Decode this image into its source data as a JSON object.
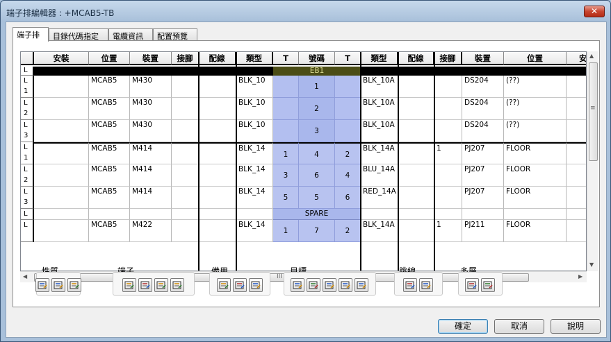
{
  "window": {
    "title": "端子排編輯器 : +MCAB5-TB",
    "close_label": "✕"
  },
  "tabs": [
    {
      "label": "端子排",
      "active": true
    },
    {
      "label": "目錄代碼指定",
      "active": false
    },
    {
      "label": "電纜資訊",
      "active": false
    },
    {
      "label": "配置預覽",
      "active": false
    }
  ],
  "grid": {
    "columns": [
      "安裝",
      "位置",
      "裝置",
      "接腳",
      "配線",
      "類型",
      "T",
      "號碼",
      "T",
      "類型",
      "配線",
      "接腳",
      "裝置",
      "位置",
      "安裝"
    ],
    "header_row": {
      "label": "L",
      "group": "EB1"
    },
    "spare_row": {
      "label": "L",
      "group": "SPARE"
    },
    "rows": [
      {
        "label_top": "L",
        "label_bottom": "1",
        "left_loc": "MCAB5",
        "left_dev": "M430",
        "left_pin": "",
        "left_type": "BLK_10",
        "t_left": "",
        "number": "1",
        "t_right": "",
        "right_type": "BLK_10A",
        "right_pin": "",
        "right_dev": "DS204",
        "right_loc": "(??)"
      },
      {
        "label_top": "L",
        "label_bottom": "2",
        "left_loc": "MCAB5",
        "left_dev": "M430",
        "left_pin": "",
        "left_type": "BLK_10",
        "t_left": "",
        "number": "2",
        "t_right": "",
        "right_type": "BLK_10A",
        "right_pin": "",
        "right_dev": "DS204",
        "right_loc": "(??)"
      },
      {
        "label_top": "L",
        "label_bottom": "3",
        "left_loc": "MCAB5",
        "left_dev": "M430",
        "left_pin": "",
        "left_type": "BLK_10",
        "t_left": "",
        "number": "3",
        "t_right": "",
        "right_type": "BLK_10A",
        "right_pin": "",
        "right_dev": "DS204",
        "right_loc": "(??)"
      },
      {
        "label_top": "L",
        "label_bottom": "1",
        "left_loc": "MCAB5",
        "left_dev": "M414",
        "left_pin": "",
        "left_type": "BLK_14",
        "t_left": "1",
        "number": "4",
        "t_right": "2",
        "right_type": "BLK_14A",
        "right_pin": "1",
        "right_dev": "PJ207",
        "right_loc": "FLOOR"
      },
      {
        "label_top": "L",
        "label_bottom": "2",
        "left_loc": "MCAB5",
        "left_dev": "M414",
        "left_pin": "",
        "left_type": "BLK_14",
        "t_left": "3",
        "number": "6",
        "t_right": "4",
        "right_type": "BLU_14A",
        "right_pin": "",
        "right_dev": "PJ207",
        "right_loc": "FLOOR"
      },
      {
        "label_top": "L",
        "label_bottom": "3",
        "left_loc": "MCAB5",
        "left_dev": "M414",
        "left_pin": "",
        "left_type": "BLK_14",
        "t_left": "5",
        "number": "5",
        "t_right": "6",
        "right_type": "RED_14A",
        "right_pin": "",
        "right_dev": "PJ207",
        "right_loc": "FLOOR"
      },
      {
        "label_top": "L",
        "label_bottom": "",
        "left_loc": "MCAB5",
        "left_dev": "M422",
        "left_pin": "",
        "left_type": "BLK_14",
        "t_left": "1",
        "number": "7",
        "t_right": "2",
        "right_type": "BLK_14A",
        "right_pin": "1",
        "right_dev": "PJ211",
        "right_loc": "FLOOR"
      }
    ],
    "hscroll_grip": "III",
    "vscroll_grip": "≡"
  },
  "toolbar_groups": [
    {
      "label": "性質",
      "icons": [
        "edit-properties-icon",
        "copy-properties-icon",
        "paste-properties-icon"
      ]
    },
    {
      "label": "端子",
      "icons": [
        "renumber-icon",
        "rotate-icon",
        "add-terminal-icon",
        "terminal-reverse-icon"
      ]
    },
    {
      "label": "備用",
      "icons": [
        "spare-insert-icon",
        "spare-left-icon",
        "spare-right-icon"
      ]
    },
    {
      "label": "目標",
      "icons": [
        "target-move-icon",
        "target-up-icon",
        "target-left-icon",
        "target-down-icon",
        "target-swap-icon"
      ]
    },
    {
      "label": "跳線",
      "icons": [
        "jumper-add-icon",
        "jumper-edit-icon"
      ]
    },
    {
      "label": "多層",
      "icons": [
        "multilevel-add-icon",
        "multilevel-remove-icon"
      ]
    }
  ],
  "buttons": {
    "ok": "確定",
    "cancel": "取消",
    "help": "說明"
  },
  "colors": {
    "terminal_fill": "#a9b7ec",
    "terminal_header": "#4b4d16",
    "header_text": "#d8d890"
  }
}
